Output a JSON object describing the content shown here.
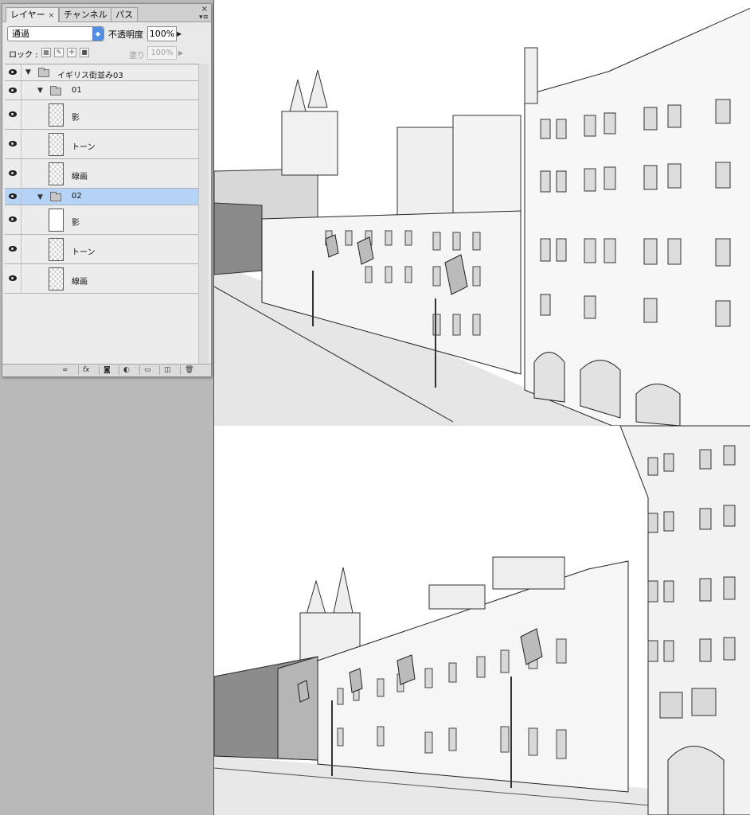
{
  "layers_panel": {
    "tabs": [
      {
        "label": "レイヤー",
        "close": "×"
      },
      {
        "label": "チャンネル"
      },
      {
        "label": "パス"
      }
    ],
    "close_glyph": "×",
    "menu_glyph": "▾≡",
    "blend_mode": "通過",
    "opacity_label": "不透明度 :",
    "opacity_value": "100%",
    "lock_label": "ロック :",
    "fill_label": "塗り :",
    "fill_value": "100%",
    "layers": [
      {
        "name": "イギリス街並み03",
        "kind": "group"
      },
      {
        "name": "01",
        "kind": "group"
      },
      {
        "name": "影",
        "kind": "layer"
      },
      {
        "name": "トーン",
        "kind": "layer"
      },
      {
        "name": "線画",
        "kind": "layer"
      },
      {
        "name": "02",
        "kind": "group",
        "selected": true
      },
      {
        "name": "影",
        "kind": "layer"
      },
      {
        "name": "トーン",
        "kind": "layer"
      },
      {
        "name": "線画",
        "kind": "layer"
      }
    ],
    "bottom_buttons": [
      "link-icon",
      "fx-icon",
      "mask-icon",
      "adjustment-icon",
      "new-group-icon",
      "new-layer-icon",
      "trash-icon"
    ],
    "fx_label": "fx",
    "selection_color": "#b5d3f7"
  },
  "canvas": {
    "background": "#ffffff"
  }
}
